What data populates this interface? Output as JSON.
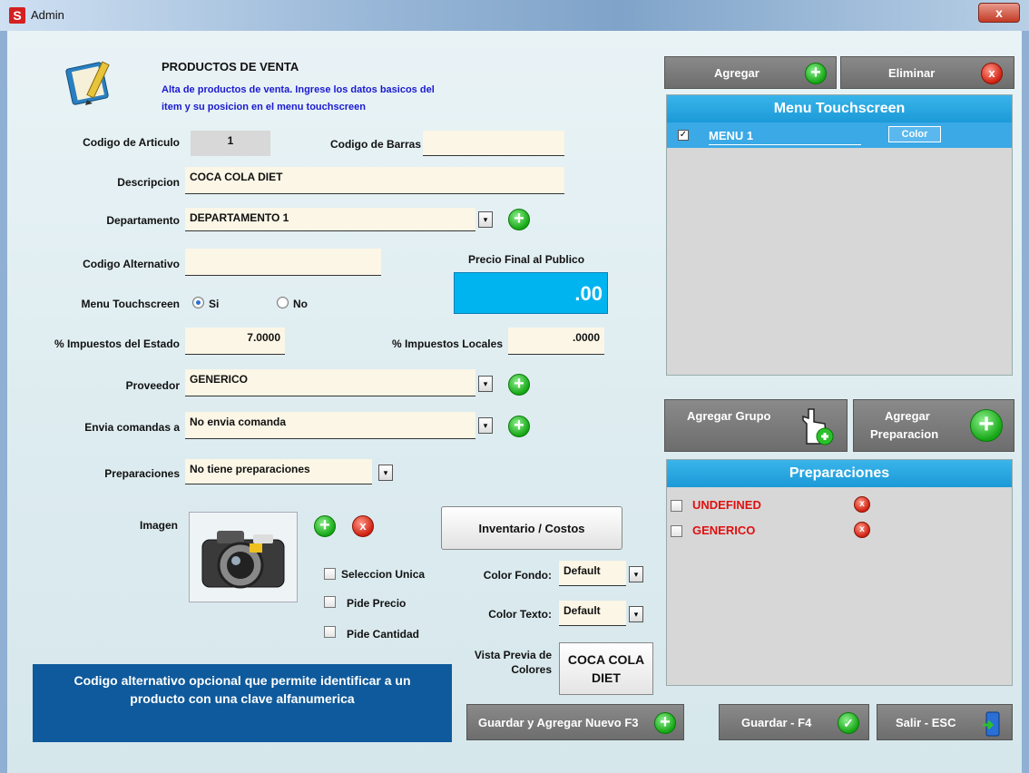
{
  "window": {
    "title": "Admin",
    "close_glyph": "x"
  },
  "header": {
    "title": "PRODUCTOS DE VENTA",
    "subtitle_line1": "Alta de productos de venta. Ingrese los datos basicos del",
    "subtitle_line2": "item y su posicion en el menu touchscreen"
  },
  "form": {
    "codigo_articulo_label": "Codigo de Articulo",
    "codigo_articulo_value": "1",
    "codigo_barras_label": "Codigo de Barras",
    "codigo_barras_value": "",
    "descripcion_label": "Descripcion",
    "descripcion_value": "COCA COLA DIET",
    "departamento_label": "Departamento",
    "departamento_value": "DEPARTAMENTO 1",
    "codigo_alternativo_label": "Codigo Alternativo",
    "codigo_alternativo_value": "",
    "precio_label": "Precio Final al Publico",
    "precio_value": ".00",
    "menu_touch_label": "Menu Touchscreen",
    "radio_si": "Si",
    "radio_no": "No",
    "imp_estado_label": "% Impuestos del Estado",
    "imp_estado_value": "7.0000",
    "imp_locales_label": "% Impuestos Locales",
    "imp_locales_value": ".0000",
    "proveedor_label": "Proveedor",
    "proveedor_value": "GENERICO",
    "envia_label": "Envia comandas a",
    "envia_value": "No envia comanda",
    "preparaciones_label": "Preparaciones",
    "preparaciones_value": "No tiene preparaciones",
    "imagen_label": "Imagen",
    "inventario_button": "Inventario / Costos",
    "seleccion_unica": "Seleccion Unica",
    "pide_precio": "Pide Precio",
    "pide_cantidad": "Pide Cantidad",
    "color_fondo_label": "Color Fondo:",
    "color_fondo_value": "Default",
    "color_texto_label": "Color Texto:",
    "color_texto_value": "Default",
    "vista_previa_label_1": "Vista Previa de",
    "vista_previa_label_2": "Colores",
    "vista_previa_text_1": "COCA COLA",
    "vista_previa_text_2": "DIET",
    "dropdown_glyph": "▾",
    "plus_glyph": "+",
    "x_glyph": "x"
  },
  "hint": {
    "line1": "Codigo alternativo opcional que permite identificar a un",
    "line2": "producto con una clave alfanumerica"
  },
  "menu_panel": {
    "agregar": "Agregar",
    "eliminar": "Eliminar",
    "header": "Menu Touchscreen",
    "items": [
      {
        "label": "MENU 1",
        "checked": true,
        "color_button": "Color",
        "check_glyph": "✓"
      }
    ]
  },
  "prep_panel": {
    "agregar_grupo": "Agregar Grupo",
    "agregar_prep_1": "Agregar",
    "agregar_prep_2": "Preparacion",
    "header": "Preparaciones",
    "items": [
      {
        "label": "UNDEFINED"
      },
      {
        "label": "GENERICO"
      }
    ]
  },
  "footer": {
    "guardar_nuevo": "Guardar y Agregar Nuevo F3",
    "guardar": "Guardar - F4",
    "salir": "Salir - ESC",
    "check_glyph": "✓"
  },
  "colors": {
    "accent_blue": "#1b9ad8",
    "price_bg": "#00b4f0",
    "hint_bg": "#0e5a9c",
    "red_text": "#e01010"
  }
}
